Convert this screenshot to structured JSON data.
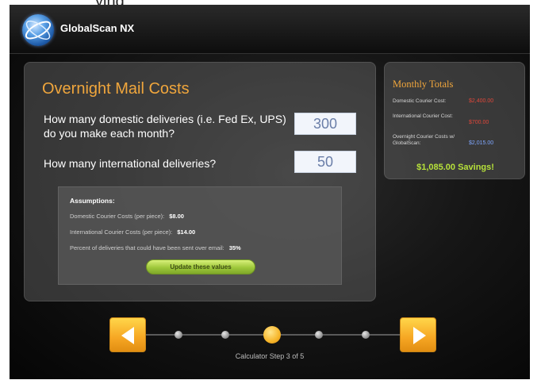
{
  "header": {
    "app_title": "GlobalScan NX",
    "clipped_top_text": "ying"
  },
  "calculator": {
    "title": "Overnight Mail Costs",
    "question_domestic": "How many domestic deliveries (i.e. Fed Ex, UPS) do you make each month?",
    "domestic_value": "300",
    "question_international": "How many international deliveries?",
    "international_value": "50"
  },
  "assumptions": {
    "title": "Assumptions:",
    "rows": [
      {
        "label": "Domestic Courier Costs (per piece):",
        "value": "$8.00"
      },
      {
        "label": "International Courier Costs (per piece):",
        "value": "$14.00"
      },
      {
        "label": "Percent of deliveries that could have been sent over email:",
        "value": "35%"
      }
    ],
    "update_button": "Update these values"
  },
  "totals": {
    "title": "Monthly Totals",
    "rows": [
      {
        "label": "Domestic Courier Cost:",
        "value": "$2,400.00"
      },
      {
        "label": "International Courier Cost:",
        "value": "$700.00"
      },
      {
        "label": "Overnight Courier Costs w/ GlobalScan:",
        "value": "$2,015.00"
      }
    ],
    "savings": "$1,085.00 Savings!"
  },
  "navigation": {
    "step_label": "Calculator Step 3 of 5",
    "current_step": 3,
    "total_steps": 5
  },
  "colors": {
    "accent_orange": "#f0a63c",
    "cost_red": "#e0473a",
    "cost_blue": "#7fa7ff",
    "savings_green": "#b7e23a"
  }
}
